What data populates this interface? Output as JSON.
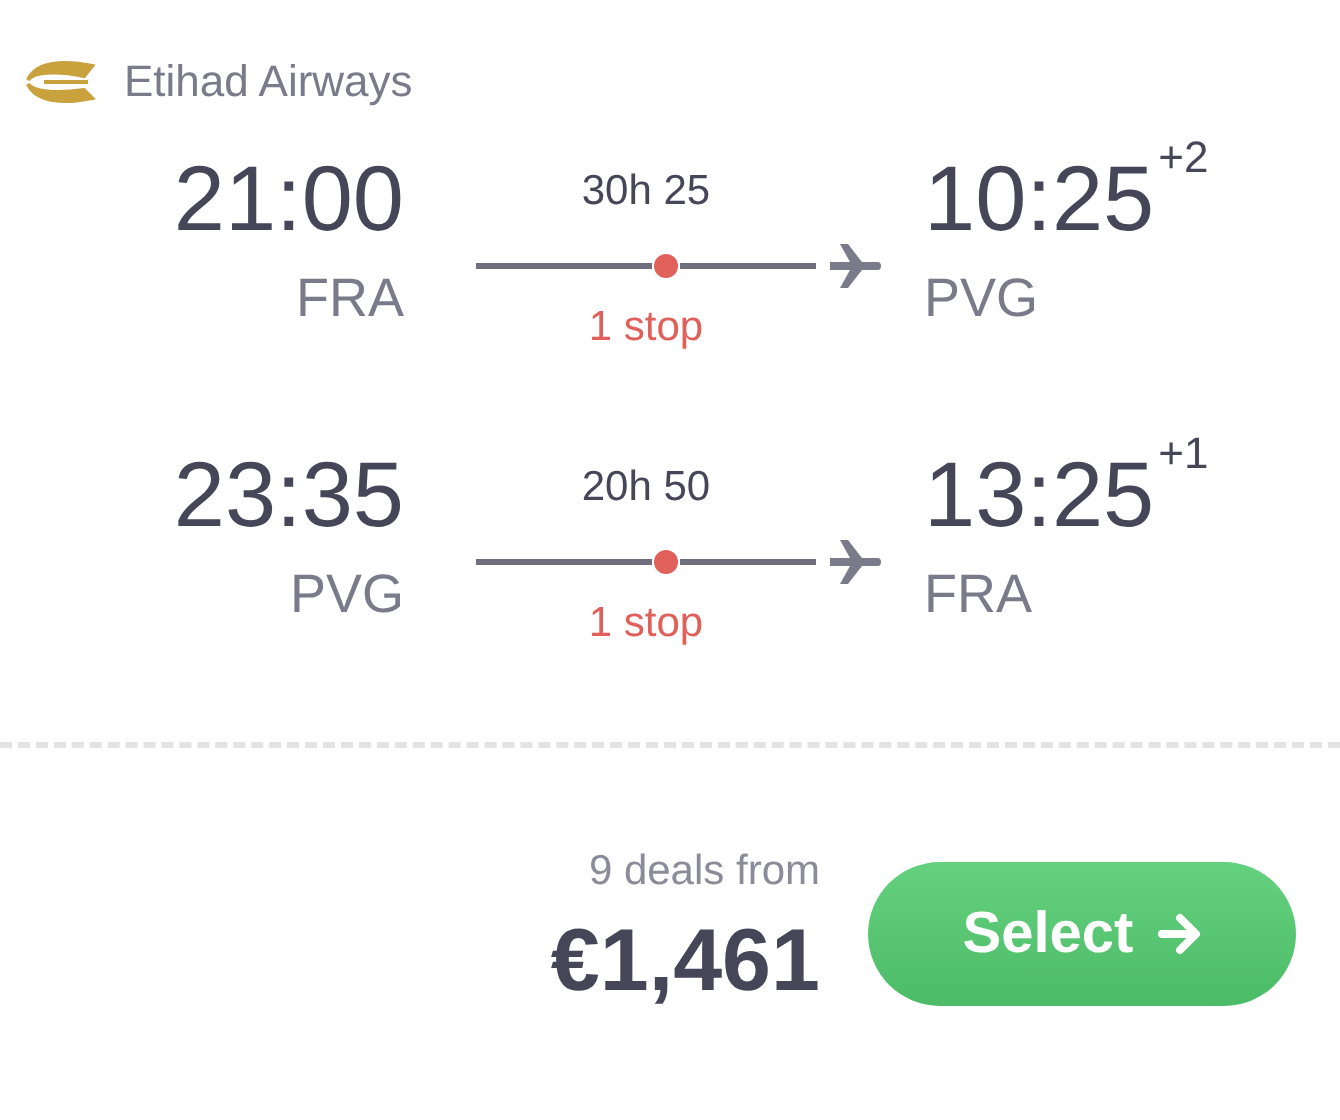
{
  "airline": {
    "name": "Etihad Airways"
  },
  "legs": [
    {
      "depart_time": "21:00",
      "depart_airport": "FRA",
      "duration": "30h 25",
      "stops": "1 stop",
      "arrive_time": "10:25",
      "day_offset": "+2",
      "arrive_airport": "PVG"
    },
    {
      "depart_time": "23:35",
      "depart_airport": "PVG",
      "duration": "20h 50",
      "stops": "1 stop",
      "arrive_time": "13:25",
      "day_offset": "+1",
      "arrive_airport": "FRA"
    }
  ],
  "footer": {
    "deals": "9 deals from",
    "price": "€1,461",
    "button": "Select"
  }
}
